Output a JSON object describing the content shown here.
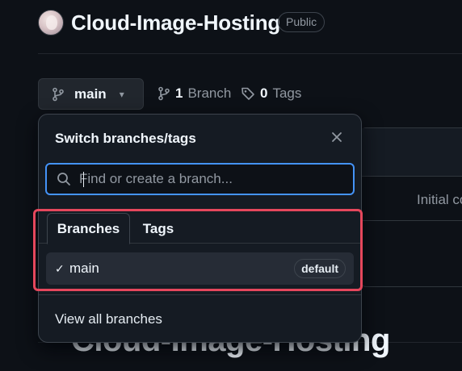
{
  "repo": {
    "name": "Cloud-Image-Hosting",
    "visibility": "Public"
  },
  "branch_bar": {
    "current_branch": "main",
    "branches_count": "1",
    "branches_label": "Branch",
    "tags_count": "0",
    "tags_label": "Tags"
  },
  "background": {
    "commit_snippet": "Initial co",
    "readme_heading": "Cloud-Image-Hosting"
  },
  "dropdown": {
    "title": "Switch branches/tags",
    "search_placeholder": "Find or create a branch...",
    "search_value": "",
    "tabs": [
      {
        "label": "Branches",
        "active": true
      },
      {
        "label": "Tags",
        "active": false
      }
    ],
    "branches": [
      {
        "name": "main",
        "badge": "default",
        "selected": true
      }
    ],
    "view_all_label": "View all branches"
  },
  "icons": {
    "branch": "git-branch-icon",
    "caret": "caret-down-icon",
    "tag": "tag-icon",
    "close": "x-icon",
    "search": "search-icon",
    "check": "check-icon"
  },
  "colors": {
    "background": "#0d1117",
    "overlay": "#151b23",
    "focus_ring": "#4493f8",
    "highlight": "#e5475c",
    "selected_row": "#262c36"
  }
}
